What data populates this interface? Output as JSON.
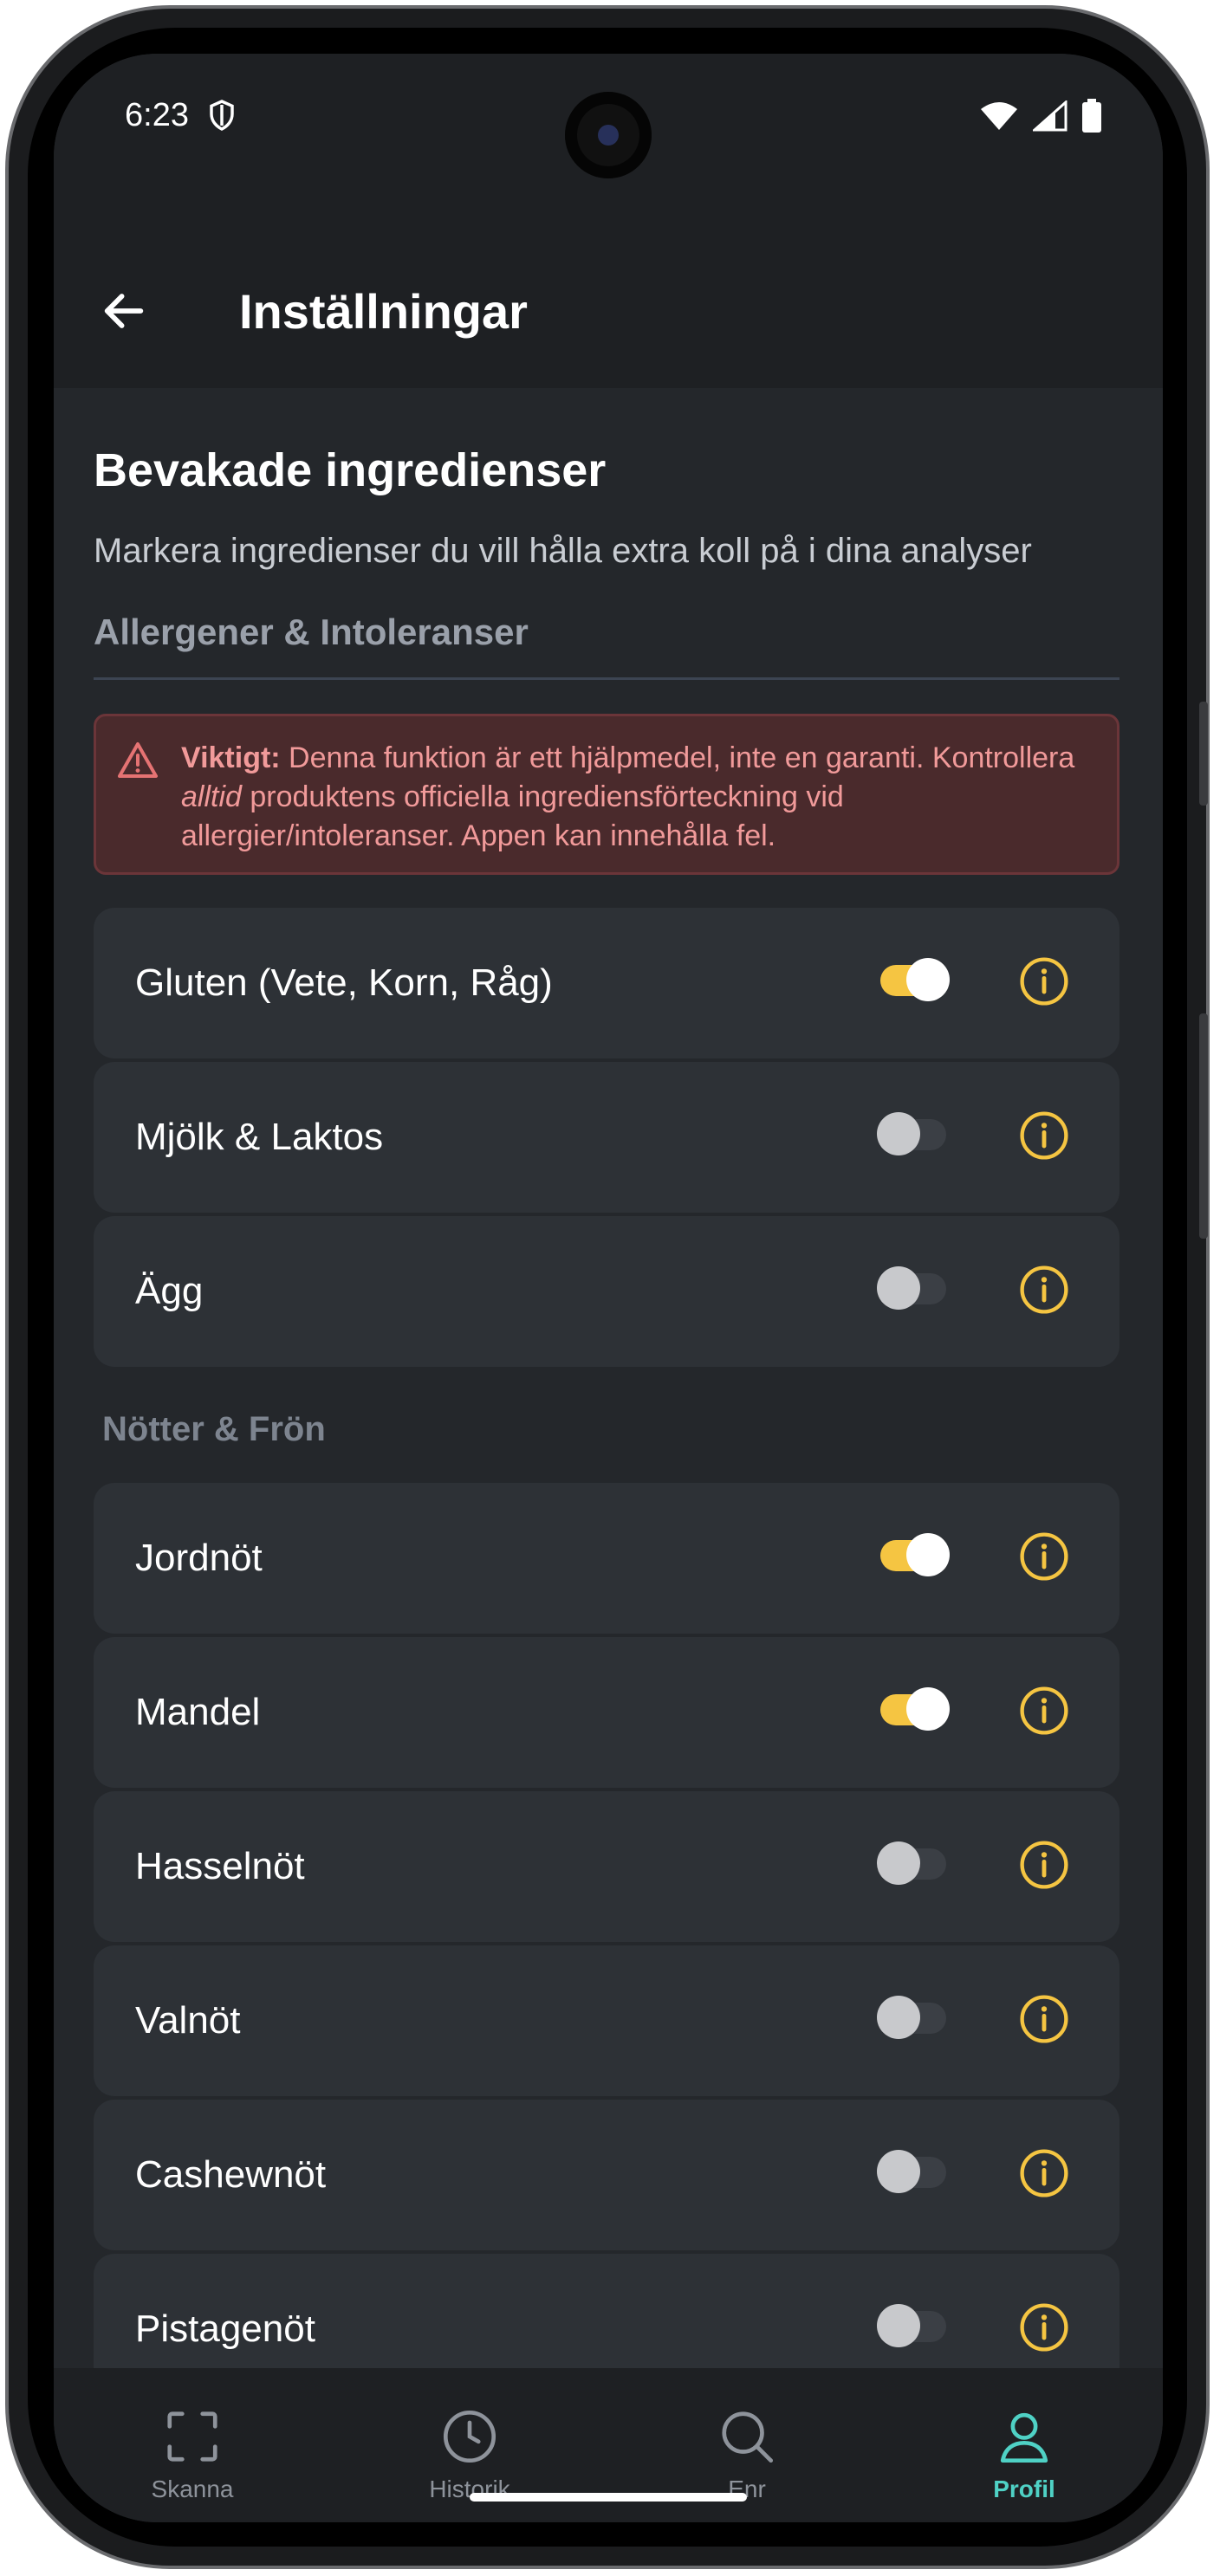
{
  "status": {
    "time": "6:23"
  },
  "appbar": {
    "title": "Inställningar"
  },
  "section": {
    "title": "Bevakade ingredienser",
    "description": "Markera ingredienser du vill hålla extra koll på i dina analyser",
    "category1": "Allergener & Intoleranser",
    "warning": {
      "strong": "Viktigt:",
      "part1": " Denna funktion är ett hjälpmedel, inte en garanti. Kontrollera ",
      "emphasis": "alltid",
      "part2": " produktens officiella ingrediensförteckning vid allergier/intoleranser. Appen kan innehålla fel."
    },
    "category2": "Nötter & Frön"
  },
  "allergens": [
    {
      "label": "Gluten (Vete, Korn, Råg)",
      "enabled": true
    },
    {
      "label": "Mjölk & Laktos",
      "enabled": false
    },
    {
      "label": "Ägg",
      "enabled": false
    }
  ],
  "nuts": [
    {
      "label": "Jordnöt",
      "enabled": true
    },
    {
      "label": "Mandel",
      "enabled": true
    },
    {
      "label": "Hasselnöt",
      "enabled": false
    },
    {
      "label": "Valnöt",
      "enabled": false
    },
    {
      "label": "Cashewnöt",
      "enabled": false
    },
    {
      "label": "Pistagenöt",
      "enabled": false
    }
  ],
  "tabs": [
    {
      "label": "Skanna",
      "icon": "scan-icon",
      "active": false
    },
    {
      "label": "Historik",
      "icon": "clock-icon",
      "active": false
    },
    {
      "label": "Enr",
      "icon": "search-icon",
      "active": false
    },
    {
      "label": "Profil",
      "icon": "person-icon",
      "active": true
    }
  ],
  "colors": {
    "accent": "#f5c542",
    "active_tab": "#4fd1c5",
    "warning_text": "#f19a9a"
  }
}
